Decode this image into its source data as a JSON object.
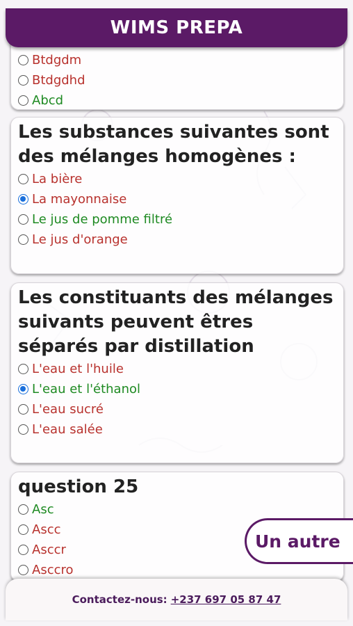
{
  "header": {
    "title": "WIMS PREPA"
  },
  "questions": [
    {
      "title": "",
      "options": [
        {
          "label": "Btdgdm",
          "color": "red",
          "selected": false
        },
        {
          "label": "Btdgdhd",
          "color": "red",
          "selected": false
        },
        {
          "label": "Abcd",
          "color": "green",
          "selected": false
        }
      ]
    },
    {
      "title": "Les substances suivantes sont des mélanges homogènes :",
      "options": [
        {
          "label": "La bière",
          "color": "red",
          "selected": false
        },
        {
          "label": "La mayonnaise",
          "color": "red",
          "selected": true
        },
        {
          "label": "Le jus de pomme filtré",
          "color": "green",
          "selected": false
        },
        {
          "label": "Le jus d'orange",
          "color": "red",
          "selected": false
        }
      ]
    },
    {
      "title": "Les constituants des mélanges suivants peuvent êtres séparés par distillation",
      "options": [
        {
          "label": "L'eau et l'huile",
          "color": "red",
          "selected": false
        },
        {
          "label": "L'eau et l'éthanol",
          "color": "green",
          "selected": true
        },
        {
          "label": "L'eau sucré",
          "color": "red",
          "selected": false
        },
        {
          "label": "L'eau salée",
          "color": "red",
          "selected": false
        }
      ]
    },
    {
      "title": "question 25",
      "options": [
        {
          "label": "Asc",
          "color": "green",
          "selected": false
        },
        {
          "label": "Ascc",
          "color": "red",
          "selected": false
        },
        {
          "label": "Asccr",
          "color": "red",
          "selected": false
        },
        {
          "label": "Asccro",
          "color": "red",
          "selected": false
        }
      ]
    }
  ],
  "float_button": {
    "label": "Un autre"
  },
  "footer": {
    "contact_label": "Contactez-nous:",
    "phone": "+237 697 05 87 47"
  },
  "colors": {
    "brand": "#5b1a66",
    "wrong": "#b8322e",
    "correct": "#1e8a22",
    "radio_selected": "#1a6fdb"
  }
}
